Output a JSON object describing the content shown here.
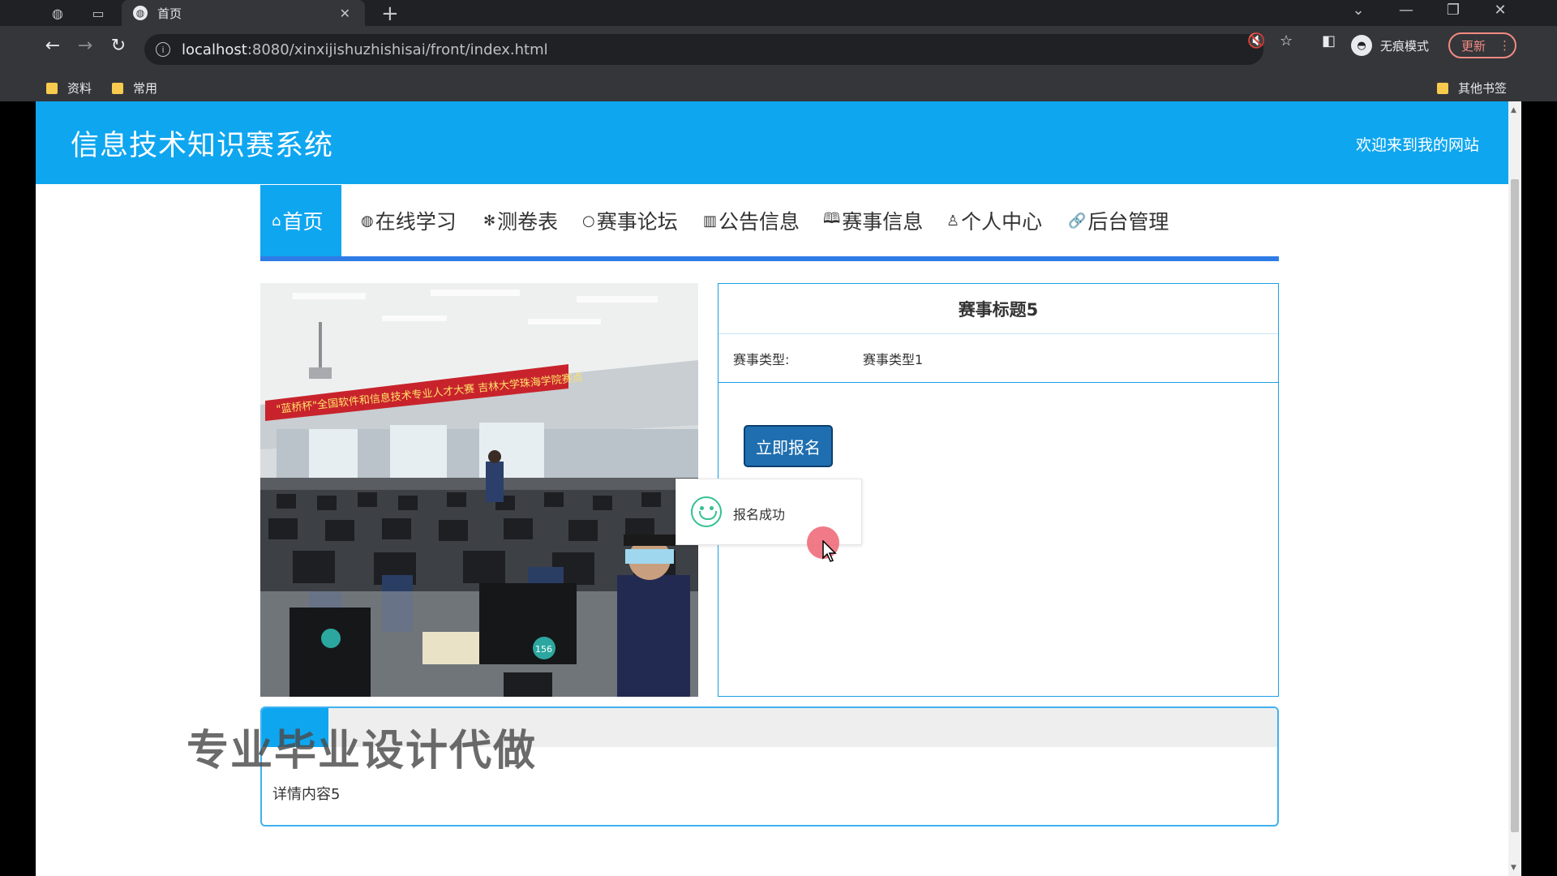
{
  "browser": {
    "tab_title": "首页",
    "url_host": "localhost",
    "url_rest": ":8080/xinxijishuzhishisai/front/index.html",
    "incognito_label": "无痕模式",
    "update_label": "更新",
    "bookmarks": [
      "资料",
      "常用"
    ],
    "other_bookmarks": "其他书签"
  },
  "header": {
    "site_title": "信息技术知识赛系统",
    "welcome": "欢迎来到我的网站"
  },
  "nav": {
    "items": [
      {
        "icon": "⌂",
        "label": "首页",
        "active": true
      },
      {
        "icon": "◍",
        "label": "在线学习"
      },
      {
        "icon": "✻",
        "label": "测卷表"
      },
      {
        "icon": "○",
        "label": "赛事论坛"
      },
      {
        "icon": "▥",
        "label": "公告信息"
      },
      {
        "icon": "🕮",
        "label": "赛事信息"
      },
      {
        "icon": "♙",
        "label": "个人中心"
      },
      {
        "icon": "🔗",
        "label": "后台管理"
      }
    ]
  },
  "event": {
    "title": "赛事标题5",
    "type_label": "赛事类型:",
    "type_value": "赛事类型1",
    "signup_button": "立即报名",
    "banner_text": "\"蓝桥杯\"全国软件和信息技术专业人才大赛  吉林大学珠海学院赛点",
    "monitor_numbers": [
      "156"
    ]
  },
  "toast": {
    "message": "报名成功"
  },
  "content": {
    "detail_text": "详情内容5"
  },
  "watermark": "专业毕业设计代做",
  "colors": {
    "header_blue": "#0fa6f0",
    "nav_underline": "#2e7ce6",
    "button_blue": "#1f6fb0",
    "toast_icon_green": "#34c191"
  }
}
